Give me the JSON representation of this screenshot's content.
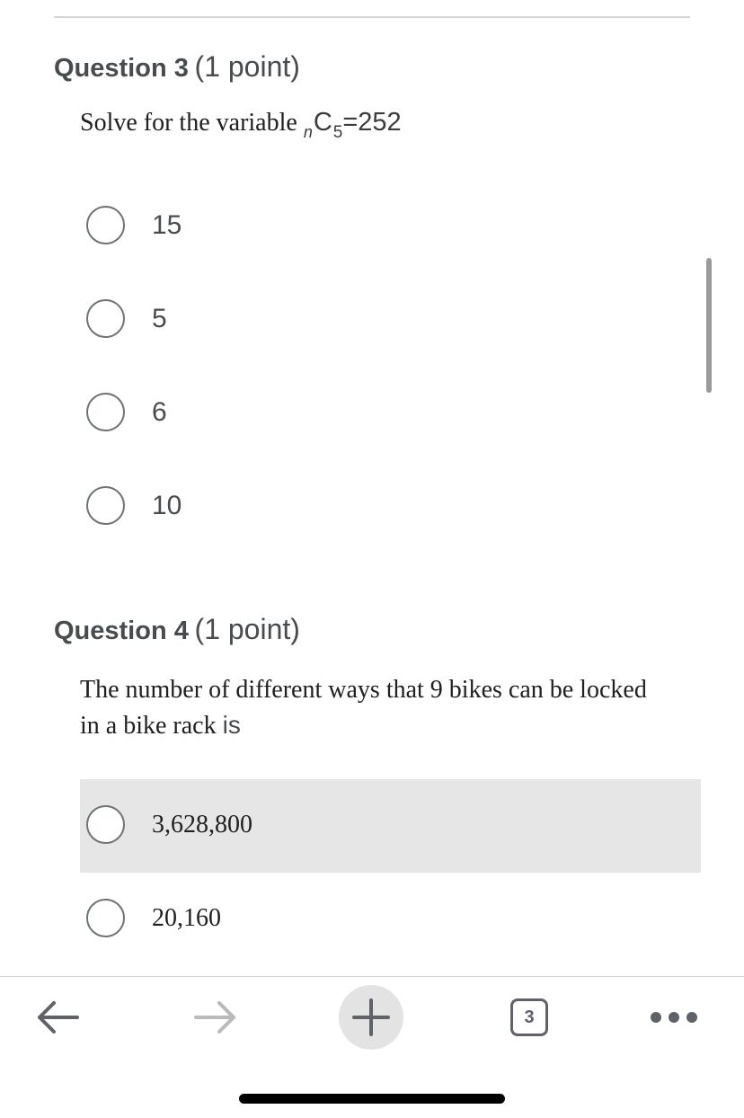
{
  "questions": [
    {
      "number_label": "Question 3",
      "points_label": "(1 point)",
      "prompt_text": "Solve for the variable",
      "prompt_math": {
        "left_subscript": "n",
        "symbol": "C",
        "right_subscript": "5",
        "equals": "=",
        "value": "252"
      },
      "options": [
        "15",
        "5",
        "6",
        "10"
      ]
    },
    {
      "number_label": "Question 4",
      "points_label": "(1 point)",
      "prompt_text": "The number of different ways that 9 bikes can be locked in a bike rack",
      "prompt_trailing": "is",
      "options": [
        "3,628,800",
        "20,160"
      ],
      "highlighted_option_index": 0
    }
  ],
  "toolbar": {
    "back_icon": "arrow-left-icon",
    "forward_icon": "arrow-right-icon",
    "new_tab_icon": "plus-icon",
    "tab_count": "3",
    "more_icon": "more-dots-icon"
  },
  "colors": {
    "text": "#494c4e",
    "serif_text": "#202020",
    "highlight": "#e6e6e6",
    "radio_border": "#6e7376"
  }
}
